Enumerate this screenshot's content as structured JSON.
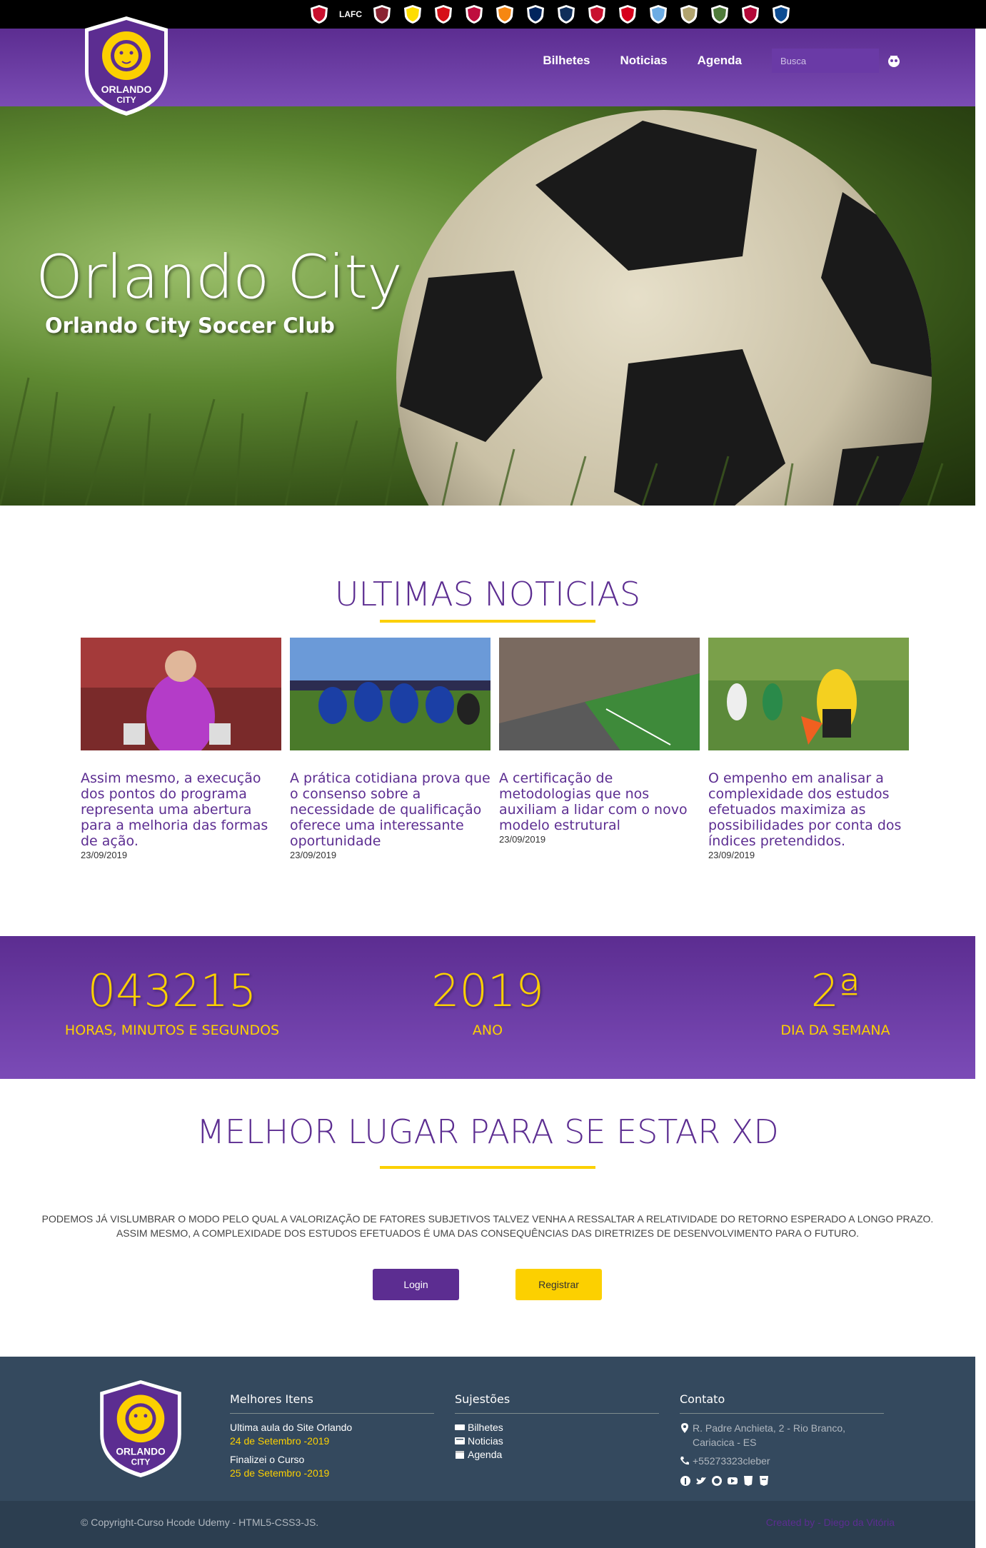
{
  "clubs": [
    {
      "name": "chicago-fire"
    },
    {
      "name": "lafc",
      "text": "LAFC"
    },
    {
      "name": "colorado-rapids"
    },
    {
      "name": "columbus-crew"
    },
    {
      "name": "dc-united"
    },
    {
      "name": "fc-dallas"
    },
    {
      "name": "houston-dynamo"
    },
    {
      "name": "la-galaxy"
    },
    {
      "name": "montreal-impact"
    },
    {
      "name": "new-england"
    },
    {
      "name": "ny-red-bulls"
    },
    {
      "name": "nycfc"
    },
    {
      "name": "philadelphia-union"
    },
    {
      "name": "portland-timbers"
    },
    {
      "name": "real-salt-lake"
    },
    {
      "name": "san-jose"
    }
  ],
  "nav": {
    "links": [
      "Bilhetes",
      "Noticias",
      "Agenda"
    ],
    "search_placeholder": "Busca"
  },
  "hero": {
    "title": "Orlando City",
    "subtitle": "Orlando City Soccer Club"
  },
  "news": {
    "title": "ULTIMAS NOTICIAS",
    "items": [
      {
        "text": "Assim mesmo, a execução dos pontos do programa representa uma abertura para a melhoria das formas de ação.",
        "date": "23/09/2019"
      },
      {
        "text": "A prática cotidiana prova que o consenso sobre a necessidade de qualificação oferece uma interessante oportunidade",
        "date": "23/09/2019"
      },
      {
        "text": "A certificação de metodologias que nos auxiliam a lidar com o novo modelo estrutural",
        "date": "23/09/2019"
      },
      {
        "text": "O empenho em analisar a complexidade dos estudos efetuados maximiza as possibilidades por conta dos índices pretendidos.",
        "date": "23/09/2019"
      }
    ]
  },
  "stats": [
    {
      "value": "043215",
      "label": "HORAS, MINUTOS E SEGUNDOS"
    },
    {
      "value": "2019",
      "label": "ANO"
    },
    {
      "value": "2ª",
      "label": "DIA DA SEMANA"
    }
  ],
  "about": {
    "title": "MELHOR LUGAR PARA SE ESTAR XD",
    "line1": "Podemos já vislumbrar o modo pelo qual a valorização de fatores subjetivos talvez venha a ressaltar a relatividade do retorno esperado a longo prazo.",
    "line2": "Assim mesmo, a complexidade dos estudos efetuados é uma das consequências das diretrizes de desenvolvimento para o futuro.",
    "login": "Login",
    "register": "Registrar"
  },
  "footer": {
    "col1": {
      "title": "Melhores Itens",
      "items": [
        {
          "text": "Ultima aula do Site Orlando",
          "date": "24 de Setembro -2019"
        },
        {
          "text": "Finalizei o Curso",
          "date": "25 de Setembro -2019"
        }
      ]
    },
    "col2": {
      "title": "Sujestões",
      "links": [
        "Bilhetes",
        "Noticias",
        "Agenda"
      ]
    },
    "col3": {
      "title": "Contato",
      "address": "R. Padre Anchieta, 2 - Rio Branco,",
      "address2": "Cariacica - ES",
      "phone": "+55273323cleber"
    },
    "copyright": "© Copyright-Curso Hcode Udemy - HTML5-CSS3-JS.",
    "created": "Created by - Diego da Vitória"
  },
  "colors": {
    "purple": "#5c2d91",
    "yellow": "#fcd000",
    "footer": "#34495e"
  }
}
